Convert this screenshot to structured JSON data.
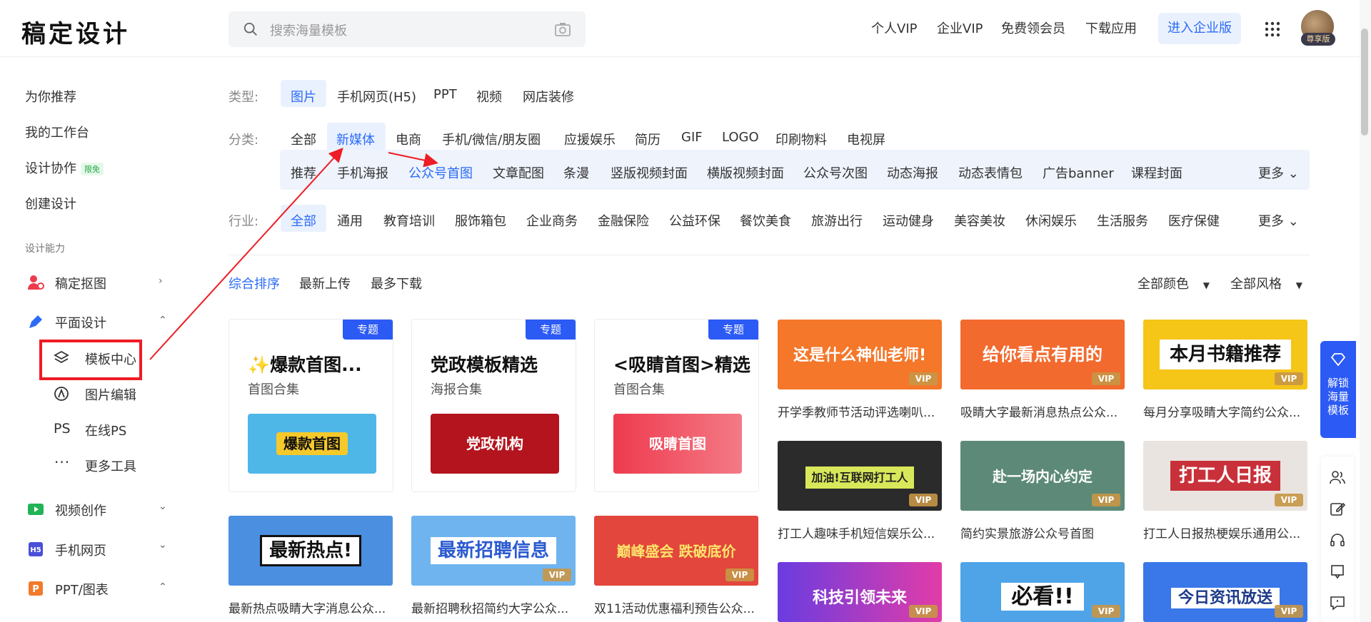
{
  "header": {
    "logo": "稿定设计",
    "search_placeholder": "搜索海量模板",
    "nav": [
      "个人VIP",
      "企业VIP",
      "免费领会员",
      "下载应用"
    ],
    "enterprise_button": "进入企业版",
    "avatar_badge": "尊享版"
  },
  "sidebar": {
    "items": [
      {
        "label": "为你推荐"
      },
      {
        "label": "我的工作台"
      },
      {
        "label": "设计协作",
        "badge": "限免"
      },
      {
        "label": "创建设计"
      }
    ],
    "section_label": "设计能力",
    "groups": [
      {
        "label": "稿定抠图",
        "icon": "person-cutout-icon"
      },
      {
        "label": "平面设计",
        "icon": "pen-icon"
      },
      {
        "label": "视频创作",
        "icon": "video-icon"
      },
      {
        "label": "手机网页",
        "icon": "h5-icon"
      },
      {
        "label": "PPT/图表",
        "icon": "ppt-icon"
      }
    ],
    "sub_items": [
      {
        "label": "模板中心",
        "icon": "layers-icon"
      },
      {
        "label": "图片编辑",
        "icon": "image-edit-icon"
      },
      {
        "label": "在线PS",
        "icon": "ps-icon"
      },
      {
        "label": "更多工具",
        "icon": "more-icon"
      }
    ]
  },
  "filters": {
    "type_label": "类型:",
    "types": [
      "图片",
      "手机网页(H5)",
      "PPT",
      "视频",
      "网店装修"
    ],
    "category_label": "分类:",
    "categories": [
      "全部",
      "新媒体",
      "电商",
      "手机/微信/朋友圈",
      "应援娱乐",
      "简历",
      "GIF",
      "LOGO",
      "印刷物料",
      "电视屏"
    ],
    "subcategories": [
      "推荐",
      "手机海报",
      "公众号首图",
      "文章配图",
      "条漫",
      "竖版视频封面",
      "横版视频封面",
      "公众号次图",
      "动态海报",
      "动态表情包",
      "广告banner",
      "课程封面"
    ],
    "more": "更多",
    "industry_label": "行业:",
    "industries": [
      "全部",
      "通用",
      "教育培训",
      "服饰箱包",
      "企业商务",
      "金融保险",
      "公益环保",
      "餐饮美食",
      "旅游出行",
      "运动健身",
      "美容美妆",
      "休闲娱乐",
      "生活服务",
      "医疗保健"
    ]
  },
  "sort": {
    "options": [
      "综合排序",
      "最新上传",
      "最多下载"
    ],
    "color": "全部颜色",
    "style": "全部风格"
  },
  "featured": [
    {
      "badge": "专题",
      "title": "✨爆款首图...",
      "subtitle": "首图合集",
      "image_text": "爆款首图",
      "color": "#f6c92b"
    },
    {
      "badge": "专题",
      "title": "党政模板精选",
      "subtitle": "海报合集",
      "image_text": "党政机构",
      "color": "#b3141d"
    },
    {
      "badge": "专题",
      "title": "<吸睛首图>精选",
      "subtitle": "首图合集",
      "image_text": "吸睛首图",
      "color": "#ee3b4e"
    }
  ],
  "templates": [
    {
      "text": "这是什么神仙老师!",
      "caption": "开学季教师节活动评选喇叭...",
      "color": "#f4772a"
    },
    {
      "text": "给你看点有用的",
      "caption": "吸睛大字最新消息热点公众...",
      "color": "#f26a2e"
    },
    {
      "text": "本月书籍推荐",
      "caption": "每月分享吸睛大字简约公众...",
      "color": "#f5c518"
    },
    {
      "text": "加油!互联网打工人",
      "caption": "打工人趣味手机短信娱乐公...",
      "color": "#2b2b2b"
    },
    {
      "text": "赴一场内心约定",
      "caption": "简约实景旅游公众号首图",
      "color": "#5d8a78"
    },
    {
      "text": "打工人日报",
      "caption": "打工人日报热梗娱乐通用公...",
      "color": "#c8313a"
    },
    {
      "text": "最新热点!",
      "caption": "最新热点吸睛大字消息公众...",
      "color": "#4b8fe0"
    },
    {
      "text": "最新招聘信息",
      "caption": "最新招聘秋招简约大字公众...",
      "color": "#6fb4ef"
    },
    {
      "text": "巅峰盛会 跌破底价",
      "caption": "双11活动优惠福利预告公众...",
      "color": "#e2463c"
    },
    {
      "text": "科技引领未来",
      "caption": "",
      "color": "#6a3ce0"
    },
    {
      "text": "必看!!",
      "caption": "",
      "color": "#4fa4e8"
    },
    {
      "text": "今日资讯放送",
      "caption": "",
      "color": "#3a77e8"
    }
  ],
  "vip_label": "VIP",
  "right_panel": {
    "text": "解锁海量模板"
  },
  "right_tools": [
    "people-icon",
    "edit-icon",
    "headset-icon",
    "flag-icon",
    "message-icon"
  ]
}
